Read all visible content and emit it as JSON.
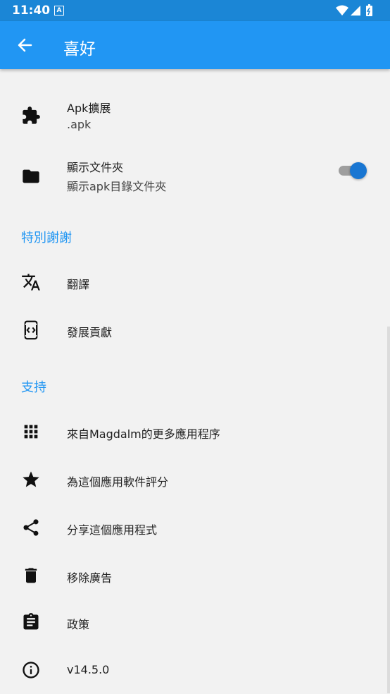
{
  "status_bar": {
    "time": "11:40",
    "notification_icon": "A"
  },
  "app_bar": {
    "title": "喜好"
  },
  "settings": [
    {
      "title": "Apk擴展",
      "subtitle": ".apk",
      "icon": "puzzle-icon"
    },
    {
      "title": "顯示文件夾",
      "subtitle": "顯示apk目錄文件夾",
      "icon": "folder-icon",
      "toggle_on": true
    }
  ],
  "sections": [
    {
      "header": "特別謝謝",
      "items": [
        {
          "label": "翻譯",
          "icon": "translate-icon"
        },
        {
          "label": "發展貢獻",
          "icon": "developer-icon"
        }
      ]
    },
    {
      "header": "支持",
      "items": [
        {
          "label": "來自Magdalm的更多應用程序",
          "icon": "apps-grid-icon"
        },
        {
          "label": "為這個應用軟件評分",
          "icon": "star-icon"
        },
        {
          "label": "分享這個應用程式",
          "icon": "share-icon"
        },
        {
          "label": "移除廣告",
          "icon": "trash-icon"
        },
        {
          "label": "政策",
          "icon": "clipboard-icon"
        },
        {
          "label": "v14.5.0",
          "icon": "info-icon"
        }
      ]
    }
  ],
  "colors": {
    "status_bar": "#1b86d6",
    "app_bar": "#2196f3",
    "accent": "#2196f3",
    "toggle_thumb": "#1976d2",
    "background": "#f2f2f2"
  }
}
